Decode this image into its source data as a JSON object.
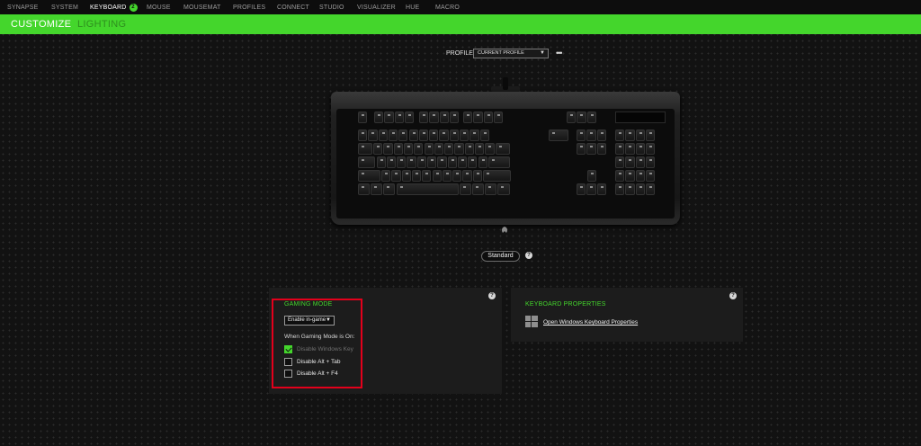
{
  "nav": {
    "tabs": [
      {
        "label": "SYNAPSE"
      },
      {
        "label": "SYSTEM"
      },
      {
        "label": "KEYBOARD",
        "badge": "2"
      },
      {
        "label": "MOUSE"
      },
      {
        "label": "MOUSEMAT"
      },
      {
        "label": "PROFILES"
      },
      {
        "label": "CONNECT"
      },
      {
        "label": "STUDIO"
      },
      {
        "label": "VISUALIZER"
      },
      {
        "label": "HUE"
      },
      {
        "label": "MACRO"
      }
    ],
    "active": "KEYBOARD"
  },
  "subnav": {
    "customize": "CUSTOMIZE",
    "lighting": "LIGHTING"
  },
  "profile": {
    "label": "PROFILE",
    "value": "CURRENT PROFILE",
    "more": "•••"
  },
  "mode": {
    "label": "Standard",
    "help": "?"
  },
  "gaming_mode": {
    "title": "GAMING MODE",
    "dropdown_value": "Enable in-game",
    "subtitle": "When Gaming Mode is On:",
    "help": "?",
    "options": [
      {
        "label": "Disable Windows Key",
        "checked": true,
        "disabled": true
      },
      {
        "label": "Disable Alt + Tab",
        "checked": false,
        "disabled": false
      },
      {
        "label": "Disable Alt + F4",
        "checked": false,
        "disabled": false
      }
    ]
  },
  "keyboard_properties": {
    "title": "KEYBOARD PROPERTIES",
    "link": "Open Windows Keyboard Properties",
    "help": "?"
  },
  "colors": {
    "accent": "#44d62c",
    "highlight": "#e3001b",
    "background": "#121212"
  },
  "icons": [
    "razer-logo-icon",
    "windows-icon",
    "help-icon",
    "chevron-down-icon",
    "more-icon"
  ]
}
